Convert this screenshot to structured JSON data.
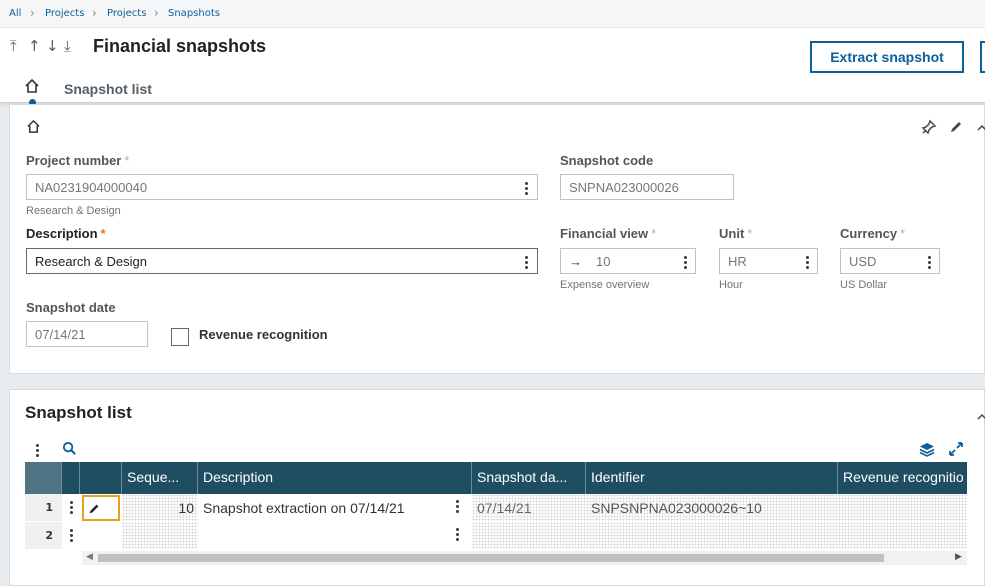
{
  "breadcrumb": [
    "All",
    "Projects",
    "Projects",
    "Snapshots"
  ],
  "header": {
    "title": "Financial snapshots",
    "extract_button": "Extract snapshot",
    "tab_label": "Snapshot list"
  },
  "form": {
    "project_number": {
      "label": "Project number",
      "value": "NA0231904000040",
      "helper": "Research & Design"
    },
    "snapshot_code": {
      "label": "Snapshot code",
      "value": "SNPNA023000026"
    },
    "description": {
      "label": "Description",
      "value": "Research & Design"
    },
    "financial_view": {
      "label": "Financial view",
      "value": "10",
      "helper": "Expense overview"
    },
    "unit": {
      "label": "Unit",
      "value": "HR",
      "helper": "Hour"
    },
    "currency": {
      "label": "Currency",
      "value": "USD",
      "helper": "US Dollar"
    },
    "snapshot_date": {
      "label": "Snapshot date",
      "value": "07/14/21"
    },
    "revenue_recognition": {
      "label": "Revenue recognition",
      "checked": false
    }
  },
  "snapshot_list": {
    "title": "Snapshot list",
    "columns": [
      "Seque...",
      "Description",
      "Snapshot da...",
      "Identifier",
      "Revenue recognitio"
    ],
    "rows": [
      {
        "num": "1",
        "sequence": "10",
        "description": "Snapshot extraction on 07/14/21",
        "date": "07/14/21",
        "identifier": "SNPSNPNA023000026~10",
        "revenue": ""
      },
      {
        "num": "2",
        "sequence": "",
        "description": "",
        "date": "",
        "identifier": "",
        "revenue": ""
      }
    ]
  },
  "colors": {
    "accent": "#0d5f9a",
    "table_header": "#1f4e63",
    "required": "#e8741b"
  }
}
